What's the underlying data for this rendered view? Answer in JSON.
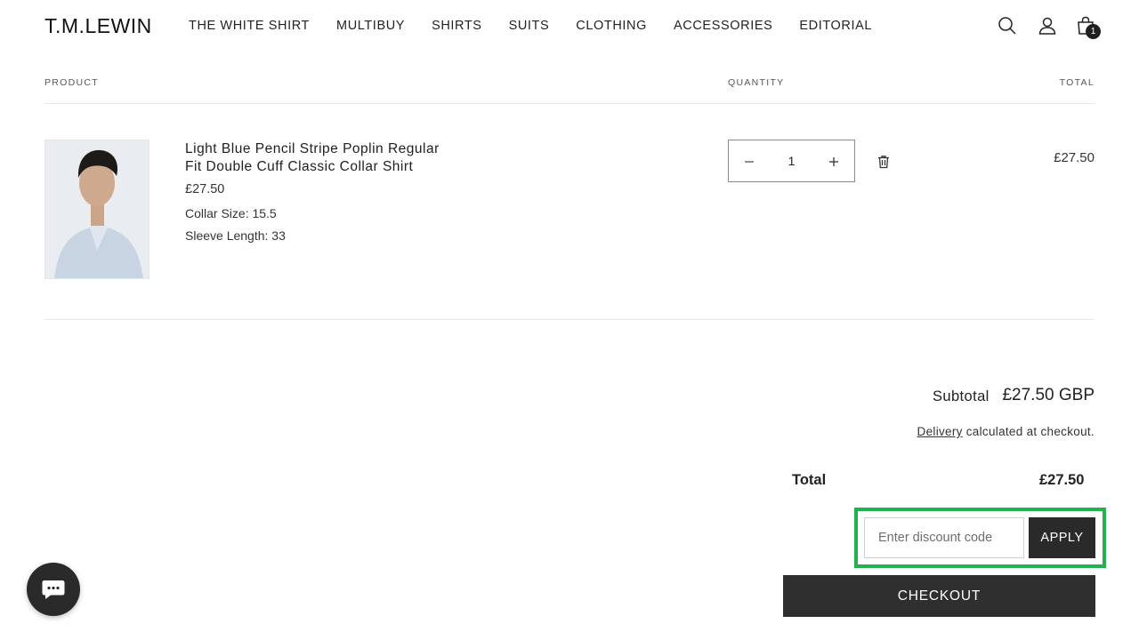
{
  "brand": {
    "logo_text": "T.M.LEWIN"
  },
  "nav": {
    "items": [
      {
        "label": "THE WHITE SHIRT"
      },
      {
        "label": "MULTIBUY"
      },
      {
        "label": "SHIRTS"
      },
      {
        "label": "SUITS"
      },
      {
        "label": "CLOTHING"
      },
      {
        "label": "ACCESSORIES"
      },
      {
        "label": "EDITORIAL"
      }
    ]
  },
  "header_icons": {
    "search": "search-icon",
    "account": "account-icon",
    "cart": "cart-icon",
    "cart_count": "1"
  },
  "cart_table": {
    "columns": {
      "product": "PRODUCT",
      "quantity": "QUANTITY",
      "total": "TOTAL"
    },
    "items": [
      {
        "name": "Light Blue Pencil Stripe Poplin Regular Fit Double Cuff Classic Collar Shirt",
        "price": "£27.50",
        "options": [
          "Collar Size: 15.5",
          "Sleeve Length: 33"
        ],
        "quantity": "1",
        "line_total": "£27.50"
      }
    ]
  },
  "summary": {
    "subtotal_label": "Subtotal",
    "subtotal_value": "£27.50 GBP",
    "delivery_link": "Delivery",
    "delivery_note": " calculated at checkout.",
    "total_label": "Total",
    "total_value": "£27.50"
  },
  "discount": {
    "placeholder": "Enter discount code",
    "value": "",
    "apply_label": "APPLY",
    "highlight_color": "#22b14c"
  },
  "checkout": {
    "label": "CHECKOUT"
  },
  "colors": {
    "primary_dark": "#2f2f2f",
    "text": "#1f1f1f",
    "divider": "#e8e8e8"
  }
}
